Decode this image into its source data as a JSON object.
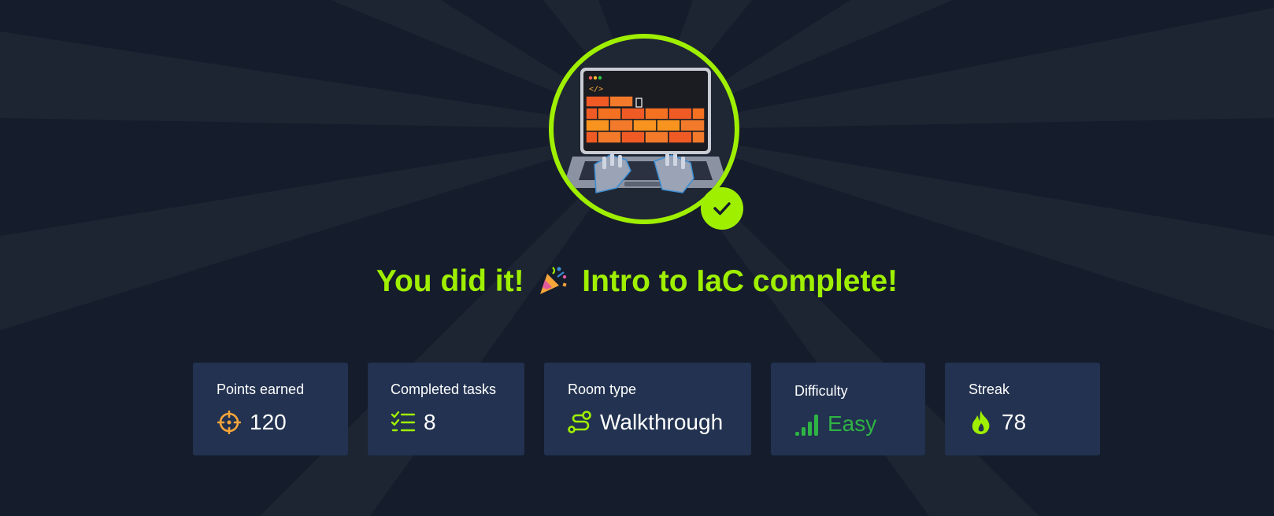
{
  "completion": {
    "title_prefix": "You did it!",
    "title_emoji": "party-popper-icon",
    "title_suffix": "Intro to IaC complete!",
    "badge_image": "laptop-robot-hands-firewall-illustration",
    "badge_status_icon": "check-icon"
  },
  "stats": [
    {
      "label": "Points earned",
      "value": "120",
      "icon": "crosshair-icon",
      "icon_color": "#f6a53a"
    },
    {
      "label": "Completed tasks",
      "value": "8",
      "icon": "task-list-icon",
      "icon_color": "#9fef00"
    },
    {
      "label": "Room type",
      "value": "Walkthrough",
      "icon": "route-icon",
      "icon_color": "#9fef00"
    },
    {
      "label": "Difficulty",
      "value": "Easy",
      "icon": "signal-bars-icon",
      "icon_color": "#2fb344"
    },
    {
      "label": "Streak",
      "value": "78",
      "icon": "flame-icon",
      "icon_color": "#9fef00"
    }
  ],
  "colors": {
    "accent": "#9fef00",
    "background": "#151c2b",
    "card": "#223250",
    "difficulty_easy": "#2fb344"
  }
}
